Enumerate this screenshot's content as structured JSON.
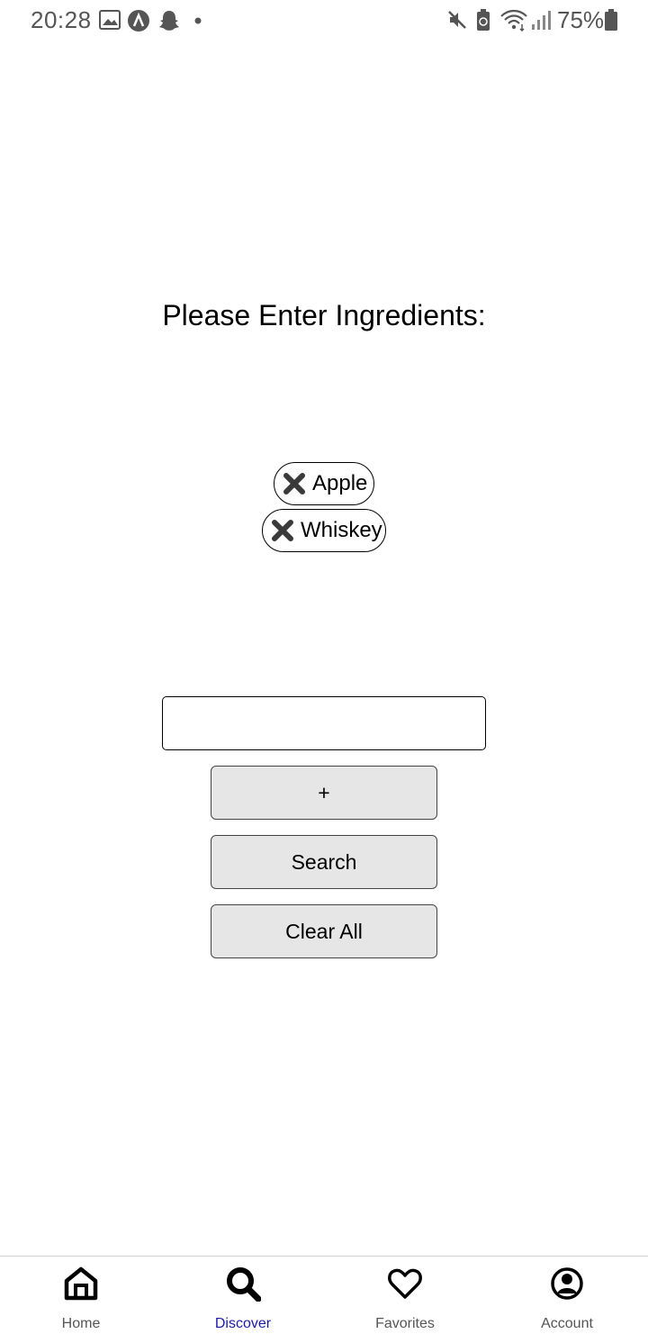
{
  "status_bar": {
    "time": "20:28",
    "battery": "75%"
  },
  "title": "Please Enter Ingredients:",
  "ingredients": [
    "Apple",
    "Whiskey"
  ],
  "input": {
    "value": "",
    "placeholder": ""
  },
  "buttons": {
    "add": "+",
    "search": "Search",
    "clear": "Clear All"
  },
  "nav": {
    "items": [
      {
        "label": "Home",
        "icon": "home-icon"
      },
      {
        "label": "Discover",
        "icon": "search-icon",
        "active": true
      },
      {
        "label": "Favorites",
        "icon": "heart-icon"
      },
      {
        "label": "Account",
        "icon": "account-icon"
      }
    ]
  },
  "colors": {
    "active_nav": "#1a1aa8",
    "button_bg": "#e6e6e6"
  }
}
